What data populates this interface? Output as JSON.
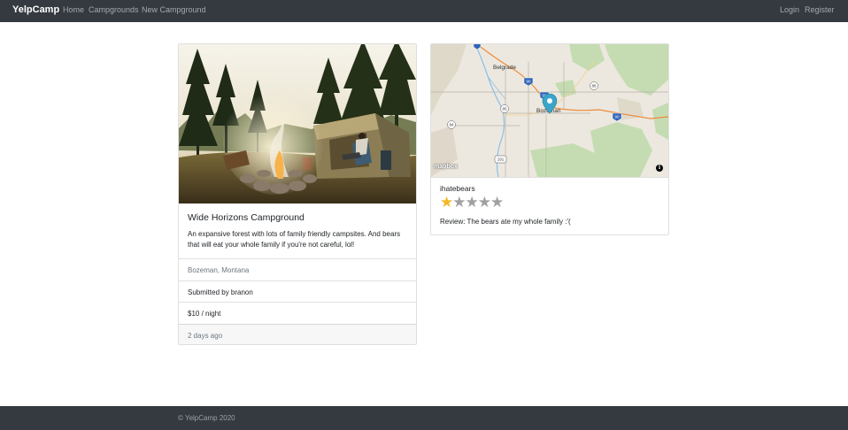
{
  "navbar": {
    "brand": "YelpCamp",
    "links": {
      "home": "Home",
      "campgrounds": "Campgrounds",
      "new_campground": "New Campground",
      "login": "Login",
      "register": "Register"
    }
  },
  "campground": {
    "title": "Wide Horizons Campground",
    "description": "An expansive forest with lots of family friendly campsites. And bears that will eat your whole family if you're not careful, lol!",
    "location": "Bozeman, Montana",
    "submitted_by": "Submitted by branon",
    "price": "$10 / night",
    "posted": "2 days ago"
  },
  "map": {
    "labels": {
      "belgrade": "Belgrade",
      "bozeman": "Bozeman"
    },
    "route_shields": [
      "90",
      "90",
      "90",
      "191",
      "85",
      "84",
      "86"
    ],
    "logo": "mapbox",
    "info_icon": "i",
    "marker_color": "#3aa5c9"
  },
  "review": {
    "username": "ihatebears",
    "rating": 1,
    "max_rating": 5,
    "star_filled_color": "#f4b725",
    "star_empty_color": "#a0a0a0",
    "text": "Review: The bears ate my whole family :'("
  },
  "footer": {
    "copyright": "© YelpCamp 2020"
  }
}
